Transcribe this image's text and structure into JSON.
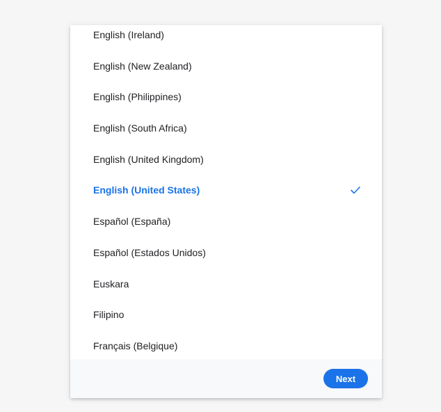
{
  "languages": [
    {
      "label": "English (Ireland)",
      "selected": false
    },
    {
      "label": "English (New Zealand)",
      "selected": false
    },
    {
      "label": "English (Philippines)",
      "selected": false
    },
    {
      "label": "English (South Africa)",
      "selected": false
    },
    {
      "label": "English (United Kingdom)",
      "selected": false
    },
    {
      "label": "English (United States)",
      "selected": true
    },
    {
      "label": "Español (España)",
      "selected": false
    },
    {
      "label": "Español (Estados Unidos)",
      "selected": false
    },
    {
      "label": "Euskara",
      "selected": false
    },
    {
      "label": "Filipino",
      "selected": false
    },
    {
      "label": "Français (Belgique)",
      "selected": false
    }
  ],
  "footer": {
    "next_label": "Next"
  },
  "colors": {
    "accent": "#1a73e8",
    "text": "#202124",
    "background": "#f6f6f7",
    "footer_bg": "#f8f9fa"
  },
  "icons": {
    "selected_marker": "checkmark-icon"
  }
}
